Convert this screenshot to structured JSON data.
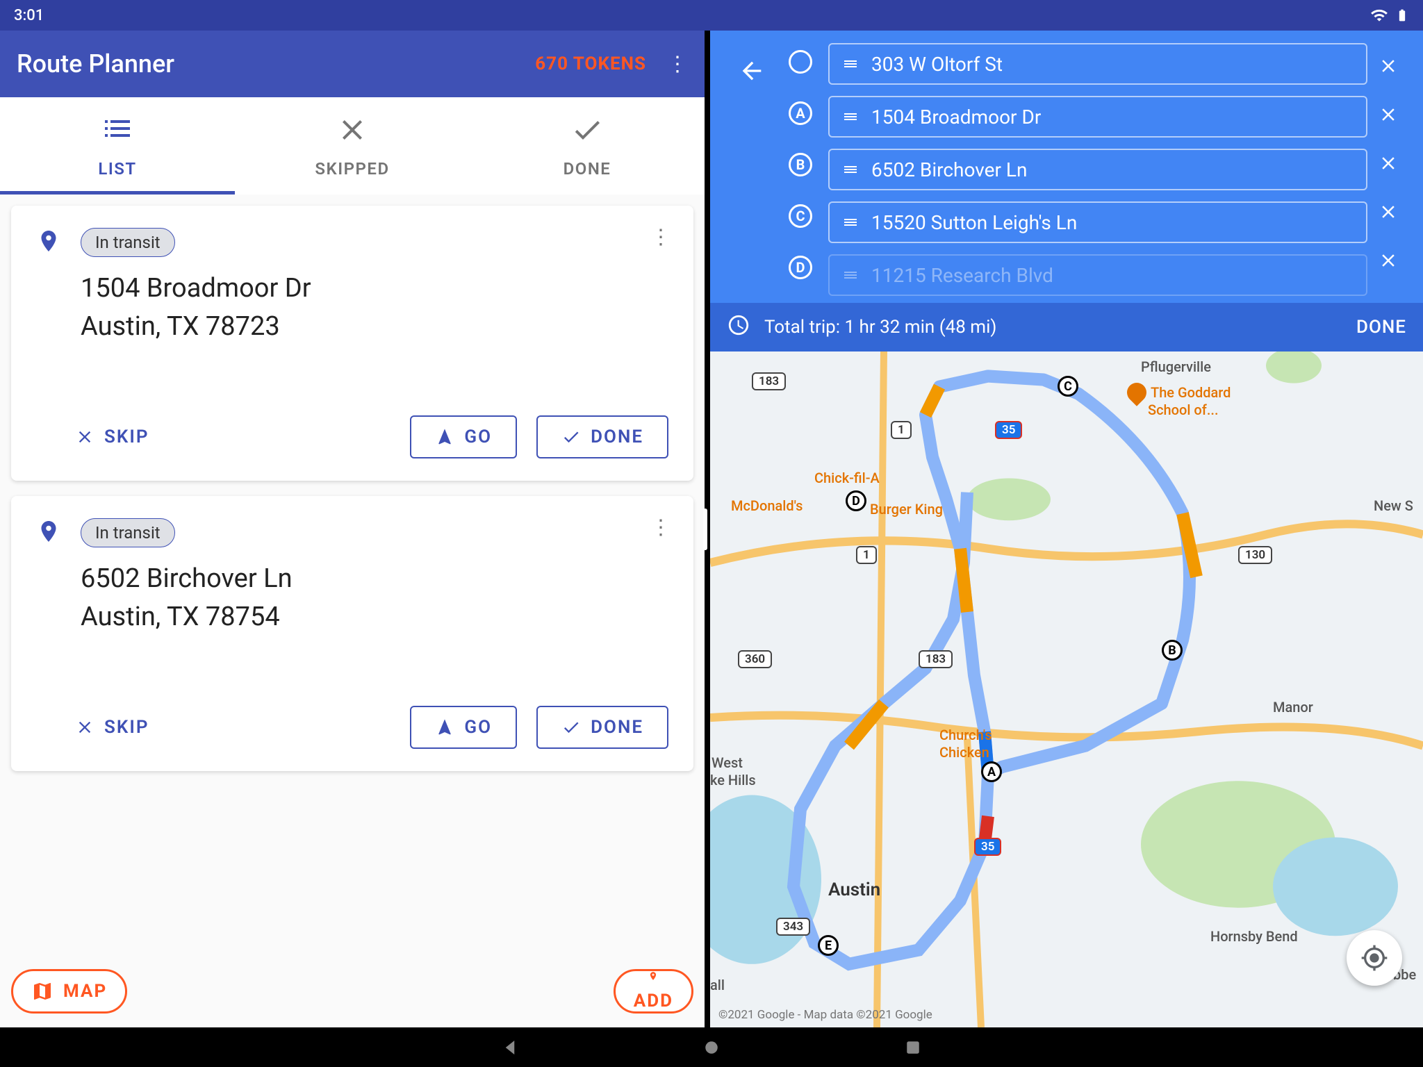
{
  "status": {
    "time": "3:01"
  },
  "left": {
    "title": "Route Planner",
    "tokens_label": "670 TOKENS",
    "tabs": {
      "list": "LIST",
      "skipped": "SKIPPED",
      "done": "DONE"
    },
    "cards": [
      {
        "chip": "In transit",
        "line1": "1504 Broadmoor Dr",
        "line2": "Austin, TX 78723",
        "skip": "SKIP",
        "go": "GO",
        "done": "DONE"
      },
      {
        "chip": "In transit",
        "line1": "6502 Birchover Ln",
        "line2": "Austin, TX 78754",
        "skip": "SKIP",
        "go": "GO",
        "done": "DONE"
      }
    ],
    "fab_map": "MAP",
    "fab_add": "ADD"
  },
  "right": {
    "stops": [
      {
        "marker": "",
        "text": "303 W Oltorf St"
      },
      {
        "marker": "A",
        "text": "1504 Broadmoor Dr"
      },
      {
        "marker": "B",
        "text": "6502 Birchover Ln"
      },
      {
        "marker": "C",
        "text": "15520 Sutton Leigh's Ln"
      },
      {
        "marker": "D",
        "text": "11215 Research Blvd"
      }
    ],
    "summary": "Total trip: 1 hr 32 min  (48 mi)",
    "done": "DONE",
    "map": {
      "labels": {
        "pflugerville": "Pflugerville",
        "manor": "Manor",
        "austin": "Austin",
        "hornsby": "Hornsby Bend",
        "newsw": "New S",
        "webbe": "Webbe",
        "wh1": "West",
        "wh2": "ke Hills",
        "all": "all",
        "mcd": "McDonald's",
        "cfa": "Chick-fil-A",
        "bk": "Burger King",
        "cc1": "Church's",
        "cc2": "Chicken",
        "god1": "The Goddard",
        "god2": "School of..."
      },
      "shields": {
        "i35a": "35",
        "i35b": "35",
        "r1a": "1",
        "r1b": "1",
        "r183a": "183",
        "r183b": "183",
        "r360": "360",
        "r343": "343",
        "r130": "130"
      },
      "credits": "©2021 Google - Map data ©2021 Google"
    }
  }
}
